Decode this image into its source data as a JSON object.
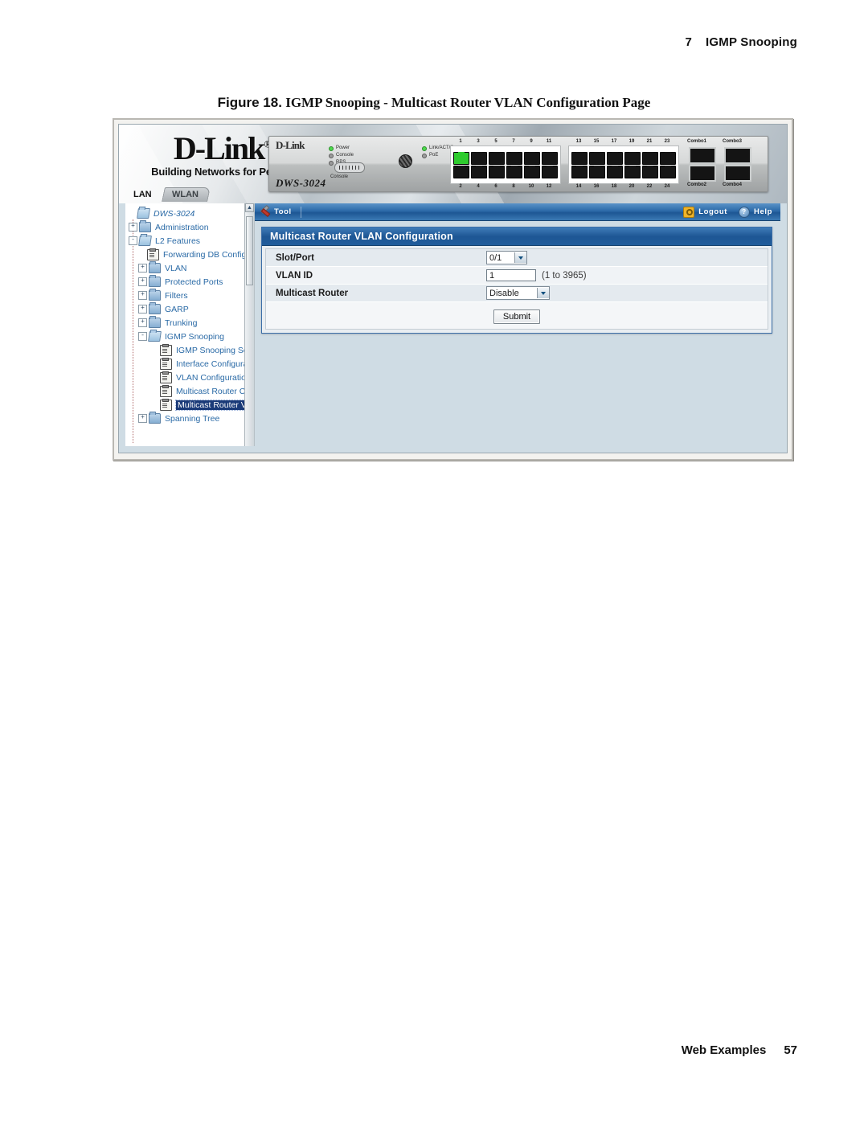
{
  "document": {
    "header": {
      "chapter_number": "7",
      "chapter_title": "IGMP Snooping"
    },
    "figure": {
      "label": "Figure 18.",
      "caption": "IGMP Snooping - Multicast Router VLAN Configuration Page"
    },
    "footer": {
      "label": "Web Examples",
      "page_number": "57"
    }
  },
  "screenshot": {
    "brand": {
      "name": "D-Link",
      "registered": "®",
      "tagline": "Building Networks for People"
    },
    "device": {
      "brand": "D-Link",
      "model": "DWS-3024",
      "leds_left": [
        "Power",
        "Console",
        "RPS"
      ],
      "leds_right": [
        "Link/ACT/Spec",
        "PoE"
      ],
      "console_label": "Console",
      "ports_top": [
        "1",
        "3",
        "5",
        "7",
        "9",
        "11",
        "13",
        "15",
        "17",
        "19",
        "21",
        "23"
      ],
      "ports_bottom": [
        "2",
        "4",
        "6",
        "8",
        "10",
        "12",
        "14",
        "16",
        "18",
        "20",
        "22",
        "24"
      ],
      "combo_top": [
        "Combo1",
        "Combo3"
      ],
      "combo_bottom": [
        "Combo2",
        "Combo4"
      ]
    },
    "tabs": [
      {
        "label": "LAN",
        "active": true
      },
      {
        "label": "WLAN",
        "active": false
      }
    ],
    "toolbar": {
      "tool_label": "Tool",
      "logout_label": "Logout",
      "help_label": "Help",
      "help_glyph": "?"
    },
    "tree": {
      "root": "DWS-3024",
      "items": [
        {
          "label": "Administration",
          "level": 1,
          "icon": "folder-icon",
          "toggle": "+"
        },
        {
          "label": "L2 Features",
          "level": 1,
          "icon": "folder-open-icon",
          "toggle": "-"
        },
        {
          "label": "Forwarding DB Configu",
          "level": 2,
          "icon": "page-icon",
          "toggle": ""
        },
        {
          "label": "VLAN",
          "level": 2,
          "icon": "folder-icon",
          "toggle": "+"
        },
        {
          "label": "Protected Ports",
          "level": 2,
          "icon": "folder-icon",
          "toggle": "+"
        },
        {
          "label": "Filters",
          "level": 2,
          "icon": "folder-icon",
          "toggle": "+"
        },
        {
          "label": "GARP",
          "level": 2,
          "icon": "folder-icon",
          "toggle": "+"
        },
        {
          "label": "Trunking",
          "level": 2,
          "icon": "folder-icon",
          "toggle": "+"
        },
        {
          "label": "IGMP Snooping",
          "level": 2,
          "icon": "folder-open-icon",
          "toggle": "-"
        },
        {
          "label": "IGMP Snooping Set",
          "level": 3,
          "icon": "page-icon",
          "toggle": ""
        },
        {
          "label": "Interface Configura",
          "level": 3,
          "icon": "page-icon",
          "toggle": ""
        },
        {
          "label": "VLAN Configuration",
          "level": 3,
          "icon": "page-icon",
          "toggle": ""
        },
        {
          "label": "Multicast Router Co",
          "level": 3,
          "icon": "page-icon",
          "toggle": ""
        },
        {
          "label": "Multicast Router VL",
          "level": 3,
          "icon": "page-icon",
          "toggle": "",
          "selected": true
        },
        {
          "label": "Spanning Tree",
          "level": 2,
          "icon": "folder-icon",
          "toggle": "+"
        }
      ],
      "scroll_up_glyph": "▲"
    },
    "panel": {
      "title": "Multicast Router VLAN Configuration",
      "fields": [
        {
          "label": "Slot/Port",
          "control": "select",
          "value": "0/1",
          "hint": ""
        },
        {
          "label": "VLAN ID",
          "control": "text",
          "value": "1",
          "hint": "(1 to 3965)"
        },
        {
          "label": "Multicast Router",
          "control": "select",
          "value": "Disable",
          "hint": ""
        }
      ],
      "submit_label": "Submit"
    }
  },
  "colors": {
    "accent_blue": "#1d5694",
    "panel_bg": "#cfdce4",
    "tree_link": "#2a6aa6",
    "selection": "#1a3a78",
    "led_on": "#4ddb4d"
  }
}
